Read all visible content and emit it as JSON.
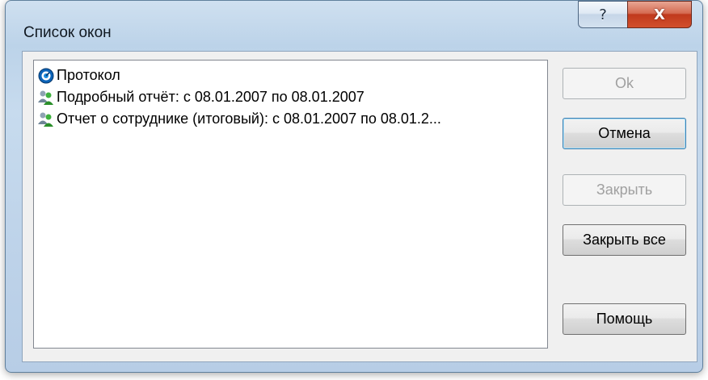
{
  "window": {
    "title": "Список окон",
    "help_button": "?",
    "close_button": "X"
  },
  "list": {
    "items": [
      {
        "label": "Протокол",
        "icon": "protocol-icon"
      },
      {
        "label": "Подробный отчёт: с 08.01.2007 по 08.01.2007",
        "icon": "users-icon"
      },
      {
        "label": "Отчет о сотруднике (итоговый): с 08.01.2007 по 08.01.2...",
        "icon": "users-icon"
      }
    ]
  },
  "buttons": {
    "ok": "Ok",
    "cancel": "Отмена",
    "close": "Закрыть",
    "close_all": "Закрыть все",
    "help": "Помощь"
  },
  "colors": {
    "frame": "#bfd4ea",
    "close_button": "#c0391c",
    "client_bg": "#f0f0f0"
  }
}
